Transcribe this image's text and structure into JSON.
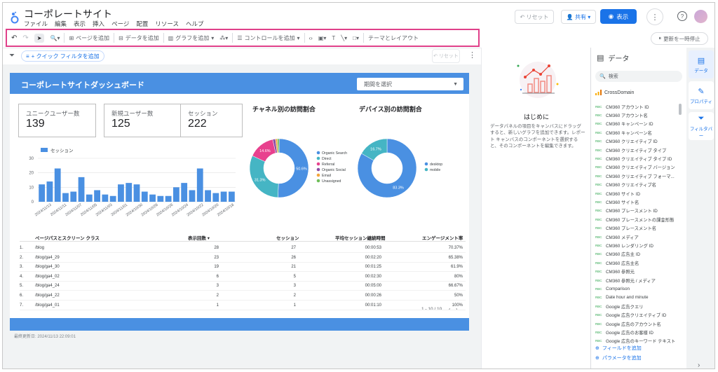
{
  "app": {
    "title": "コーポレートサイト"
  },
  "menu": [
    "ファイル",
    "編集",
    "表示",
    "挿入",
    "ページ",
    "配置",
    "リソース",
    "ヘルプ"
  ],
  "header": {
    "reset": "リセット",
    "share": "共有",
    "view": "表示",
    "help_icon": "help-circle-icon"
  },
  "toolbar": {
    "add_page": "ページを追加",
    "add_data": "データを追加",
    "add_chart": "グラフを追加",
    "add_control": "コントロールを追加",
    "theme_layout": "テーマとレイアウト"
  },
  "pause": "更新を一時停止",
  "filterbar": {
    "quick_filter": "+ クイック フィルタを追加",
    "reset": "リセット"
  },
  "report": {
    "title": "コーポレートサイトダッシュボード",
    "period": "期間を選択",
    "kpis": [
      {
        "label": "ユニークユーザー数",
        "value": "139"
      },
      {
        "label": "新規ユーザー数",
        "value": "125"
      },
      {
        "label": "セッション",
        "value": "222"
      }
    ],
    "channel_title": "チャネル別の訪問割合",
    "device_title": "デバイス別の訪問割合",
    "updated": "最終更新日: 2024/11/13 22:09:01",
    "pager": "1 - 10 / 10"
  },
  "table": {
    "headers": [
      "ページパスとスクリーン クラス",
      "表示回数 ▾",
      "セッション",
      "平均セッション継続時間",
      "エンゲージメント率"
    ],
    "rows": [
      [
        "1.",
        "/blog",
        "28",
        "27",
        "00:00:53",
        "70.37%"
      ],
      [
        "2.",
        "/blog/ga4_29",
        "23",
        "26",
        "00:02:20",
        "65.38%"
      ],
      [
        "3.",
        "/blog/ga4_30",
        "19",
        "21",
        "00:01:25",
        "61.9%"
      ],
      [
        "4.",
        "/blog/ga4_02",
        "6",
        "5",
        "00:02:30",
        "80%"
      ],
      [
        "5.",
        "/blog/ga4_24",
        "3",
        "3",
        "00:05:00",
        "66.67%"
      ],
      [
        "6.",
        "/blog/ga4_22",
        "2",
        "2",
        "00:00:26",
        "50%"
      ],
      [
        "7.",
        "/blog/ga4_01",
        "1",
        "1",
        "00:01:10",
        "100%"
      ]
    ]
  },
  "intro": {
    "title": "はじめに",
    "desc": "データパネルの項目をキャンバスにドラッグすると、新しいグラフを追加できます。レポート キャンバスのコンポーネントを選択すると、そのコンポーネントを編集できます。"
  },
  "datapanel": {
    "title": "データ",
    "search": "検索",
    "source": "CrossDomain",
    "fields": [
      "CM360 アカウント ID",
      "CM360 アカウント名",
      "CM360 キャンペーン ID",
      "CM360 キャンペーン名",
      "CM360 クリエイティブ ID",
      "CM360 クリエイティブ タイプ",
      "CM360 クリエイティブ タイプ ID",
      "CM360 クリエイティブ バージョン",
      "CM360 クリエイティブ フォーマ...",
      "CM360 クリエイティブ名",
      "CM360 サイト ID",
      "CM360 サイト名",
      "CM360 プレースメント ID",
      "CM360 プレースメントの課金形態",
      "CM360 プレースメント名",
      "CM360 メディア",
      "CM360 レンダリング ID",
      "CM360 広告主 ID",
      "CM360 広告主名",
      "CM360 参照元",
      "CM360 参照元 / メディア",
      "Comparison",
      "Date hour and minute",
      "Google 広告クエリ",
      "Google 広告クリエイティブ ID",
      "Google 広告のアカウント名",
      "Google 広告のお客様 ID",
      "Google 広告のキーワード テキスト"
    ],
    "add_field": "フィールドを追加",
    "add_param": "パラメータを追加"
  },
  "rail": {
    "data": "データ",
    "properties": "プロパティ",
    "filter": "フィルタバー"
  },
  "chart_data": [
    {
      "type": "bar",
      "legend": [
        "セッション"
      ],
      "ylim": [
        0,
        30
      ],
      "yticks": [
        "0",
        "10",
        "20",
        "30"
      ],
      "xticks": [
        "2024/11/13",
        "2024/11/11",
        "2024/11/07",
        "2024/11/05",
        "2024/11/03",
        "2024/11/01",
        "2024/10/30",
        "2024/10/28",
        "2024/10/26",
        "2024/10/24",
        "2024/10/22",
        "2024/10/20",
        "2024/10/18"
      ],
      "values": [
        12,
        14,
        23,
        6,
        7,
        17,
        5,
        8,
        5,
        4,
        12,
        13,
        12,
        7,
        5,
        4,
        4,
        10,
        13,
        8,
        23,
        8,
        6,
        7,
        7
      ],
      "color": "#4a90e2"
    },
    {
      "type": "pie",
      "slices": [
        {
          "name": "Organic Search",
          "value": 50.6,
          "color": "#4a90e2"
        },
        {
          "name": "Direct",
          "value": 31.3,
          "color": "#45b5c4"
        },
        {
          "name": "Referral",
          "value": 14.6,
          "color": "#e8418e"
        },
        {
          "name": "Organic Social",
          "value": 1.5,
          "color": "#8b4da5"
        },
        {
          "name": "Email",
          "value": 1.0,
          "color": "#f4a63b"
        },
        {
          "name": "Unassigned",
          "value": 1.0,
          "color": "#6fbe5a"
        }
      ],
      "labels": [
        "50.6%",
        "31.3%",
        "14.6%"
      ]
    },
    {
      "type": "pie",
      "slices": [
        {
          "name": "desktop",
          "value": 83.3,
          "color": "#4a90e2"
        },
        {
          "name": "mobile",
          "value": 16.7,
          "color": "#45b5c4"
        }
      ],
      "labels": [
        "83.3%",
        "16.7%"
      ]
    }
  ]
}
